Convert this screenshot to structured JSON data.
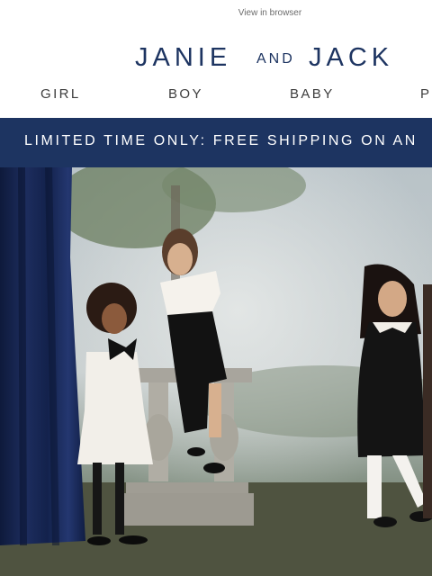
{
  "header": {
    "view_in_browser": "View in browser"
  },
  "brand": {
    "logo_text": "JANIE AND JACK",
    "logo_big_1": "JANIE",
    "logo_small": "AND",
    "logo_big_2": "JACK",
    "color": "#1d3461"
  },
  "nav": {
    "items": [
      {
        "label": "GIRL"
      },
      {
        "label": "BOY"
      },
      {
        "label": "BABY"
      },
      {
        "label": "P"
      }
    ]
  },
  "promo": {
    "text": "LIMITED TIME ONLY: FREE SHIPPING ON AN"
  },
  "hero": {
    "alt": "Children in black and white holiday outfits posing in a painted-backdrop studio"
  },
  "colors": {
    "banner": "#1d3461",
    "nav_text": "#3d3d3d"
  }
}
